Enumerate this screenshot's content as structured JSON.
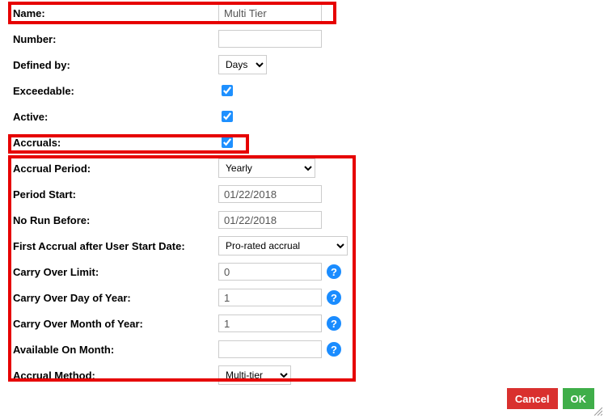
{
  "fields": {
    "name": {
      "label": "Name:",
      "value": "Multi Tier"
    },
    "number": {
      "label": "Number:",
      "value": ""
    },
    "definedBy": {
      "label": "Defined by:",
      "value": "Days"
    },
    "exceedable": {
      "label": "Exceedable:"
    },
    "active": {
      "label": "Active:"
    },
    "accruals": {
      "label": "Accruals:"
    },
    "accrualPeriod": {
      "label": "Accrual Period:",
      "value": "Yearly"
    },
    "periodStart": {
      "label": "Period Start:",
      "value": "01/22/2018"
    },
    "noRunBefore": {
      "label": "No Run Before:",
      "value": "01/22/2018"
    },
    "firstAccrual": {
      "label": "First Accrual after User Start Date:",
      "value": "Pro-rated accrual"
    },
    "carryOverLimit": {
      "label": "Carry Over Limit:",
      "value": "0"
    },
    "carryOverDay": {
      "label": "Carry Over Day of Year:",
      "value": "1"
    },
    "carryOverMonth": {
      "label": "Carry Over Month of Year:",
      "value": "1"
    },
    "availableOnMonth": {
      "label": "Available On Month:",
      "value": ""
    },
    "accrualMethod": {
      "label": "Accrual Method:",
      "value": "Multi-tier"
    }
  },
  "buttons": {
    "cancel": "Cancel",
    "ok": "OK"
  },
  "help": "?"
}
